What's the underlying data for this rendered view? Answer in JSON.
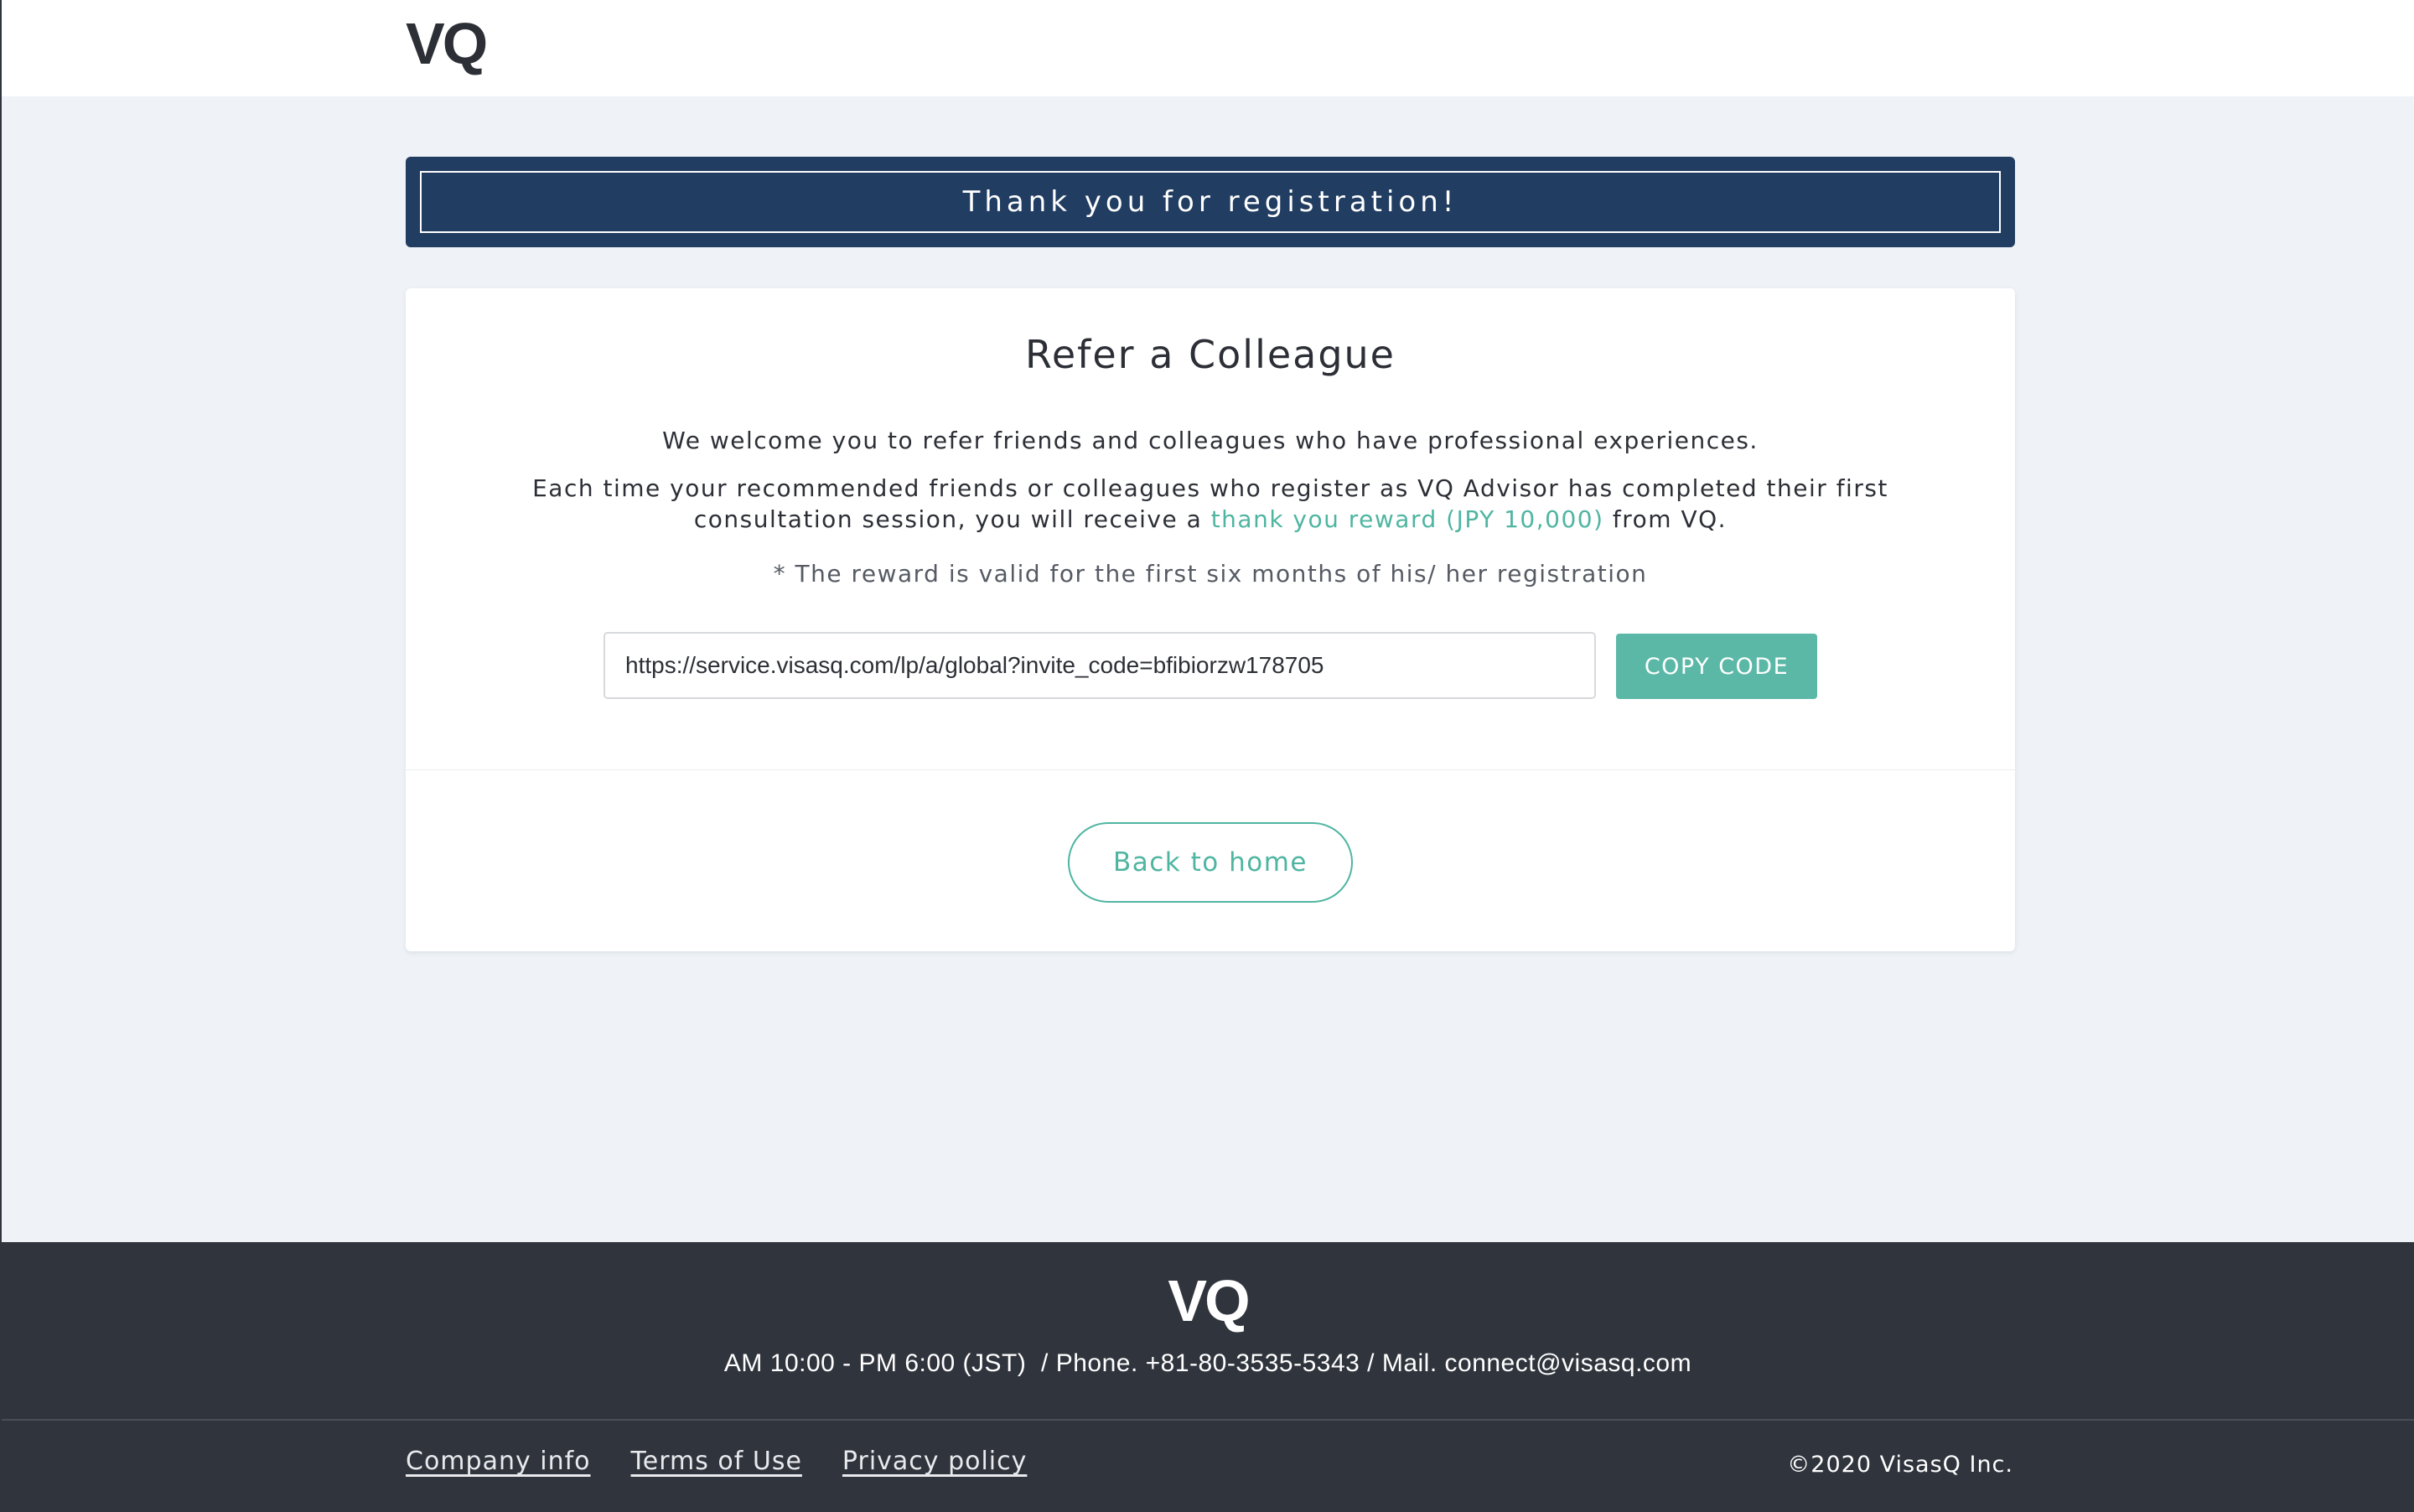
{
  "header": {
    "logo": "VQ"
  },
  "banner": {
    "text": "Thank you for registration!"
  },
  "card": {
    "title": "Refer a Colleague",
    "welcome_text": "We welcome you to refer friends and colleagues who have professional experiences.",
    "each_text_before": "Each time your recommended friends or colleagues who register as VQ Advisor has completed their first consultation session, you will receive a ",
    "reward_link": "thank you reward (JPY 10,000)",
    "each_text_after": " from VQ.",
    "note": "* The reward is valid for the first six months of his/ her registration",
    "invite_url": "https://service.visasq.com/lp/a/global?invite_code=bfibiorzw178705",
    "copy_button": "COPY CODE",
    "home_button": "Back to home"
  },
  "footer": {
    "logo": "VQ",
    "contact": "AM 10:00 - PM 6:00 (JST)  / Phone. +81-80-3535-5343 / Mail. connect@visasq.com",
    "links": [
      "Company info",
      "Terms of Use",
      "Privacy policy"
    ],
    "copyright": "©2020 VisasQ Inc."
  },
  "colors": {
    "banner_bg": "#213d61",
    "accent": "#5bb8a6",
    "footer_bg": "#30343d",
    "page_bg": "#eff3f8"
  }
}
